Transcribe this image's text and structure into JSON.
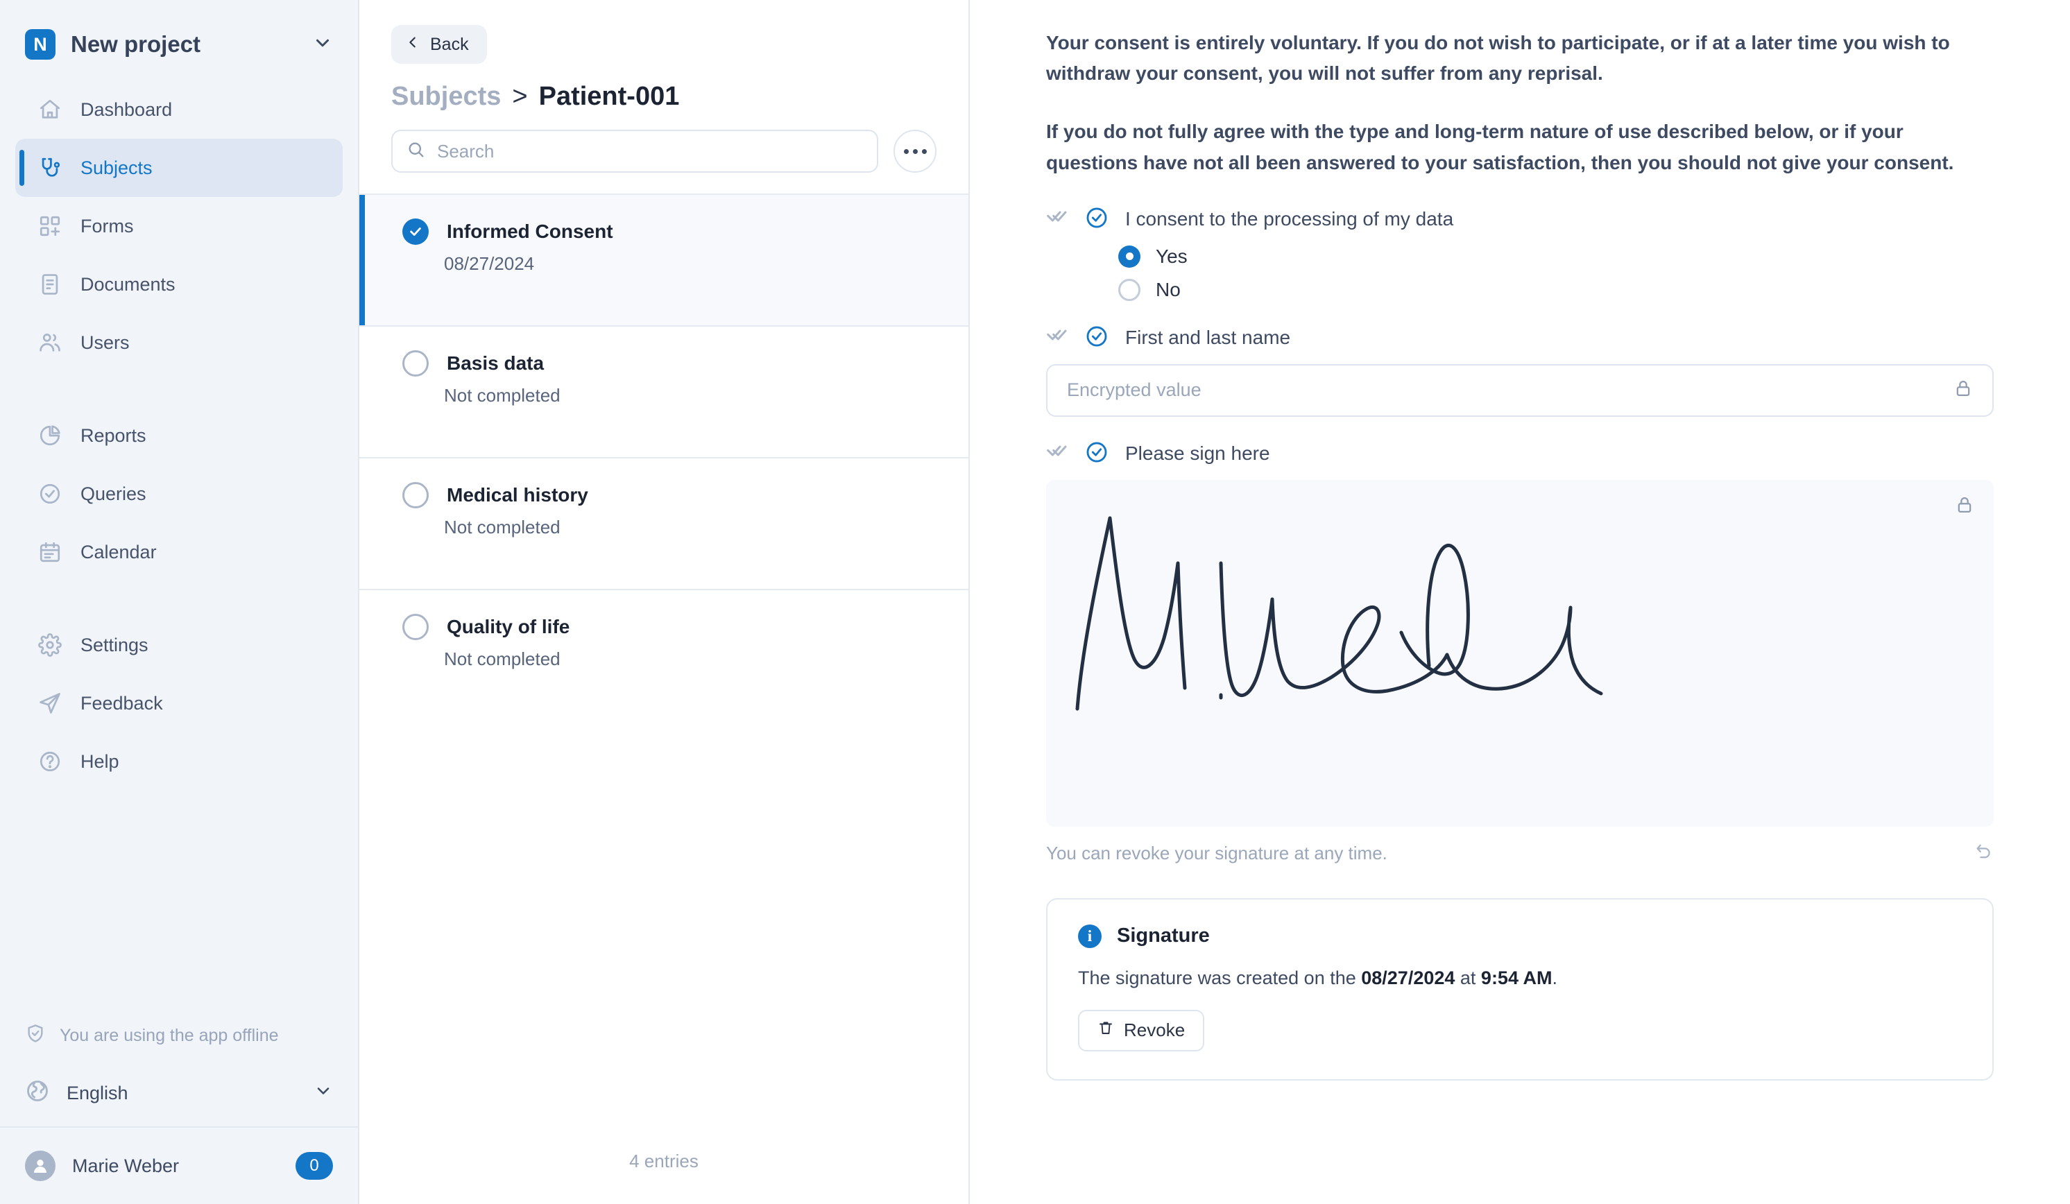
{
  "sidebar": {
    "project": {
      "logo_letter": "N",
      "name": "New project",
      "chevron_icon": "chevron-down-icon"
    },
    "items": [
      {
        "label": "Dashboard",
        "icon": "home-icon",
        "active": false
      },
      {
        "label": "Subjects",
        "icon": "stethoscope-icon",
        "active": true
      },
      {
        "label": "Forms",
        "icon": "forms-grid-plus-icon",
        "active": false
      },
      {
        "label": "Documents",
        "icon": "document-icon",
        "active": false
      },
      {
        "label": "Users",
        "icon": "users-icon",
        "active": false
      },
      {
        "label": "Reports",
        "icon": "pie-chart-icon",
        "active": false
      },
      {
        "label": "Queries",
        "icon": "check-circle-icon",
        "active": false
      },
      {
        "label": "Calendar",
        "icon": "calendar-icon",
        "active": false
      },
      {
        "label": "Settings",
        "icon": "gear-icon",
        "active": false
      },
      {
        "label": "Feedback",
        "icon": "paper-plane-icon",
        "active": false
      },
      {
        "label": "Help",
        "icon": "question-circle-icon",
        "active": false
      }
    ],
    "offline_status": "You are using the app offline",
    "offline_icon": "shield-check-icon",
    "language": "English",
    "language_icon": "globe-icon",
    "user": {
      "name": "Marie Weber",
      "badge_count": "0",
      "avatar_icon": "user-avatar-icon"
    }
  },
  "list_panel": {
    "back_label": "Back",
    "back_icon": "chevron-left-icon",
    "breadcrumb": {
      "parent": "Subjects",
      "separator": ">",
      "current": "Patient-001"
    },
    "search": {
      "placeholder": "Search",
      "value": "",
      "icon": "search-icon"
    },
    "more_button_icon": "ellipsis-icon",
    "items": [
      {
        "title": "Informed Consent",
        "subtitle": "08/27/2024",
        "completed": true,
        "selected": true
      },
      {
        "title": "Basis data",
        "subtitle": "Not completed",
        "completed": false,
        "selected": false
      },
      {
        "title": "Medical history",
        "subtitle": "Not completed",
        "completed": false,
        "selected": false
      },
      {
        "title": "Quality of life",
        "subtitle": "Not completed",
        "completed": false,
        "selected": false
      }
    ],
    "entries_count": "4 entries"
  },
  "detail": {
    "paragraph_1": "Your consent is entirely voluntary. If you do not wish to participate, or if at a later time you wish to withdraw your consent, you will not suffer from any reprisal.",
    "paragraph_2": "If you do not fully agree with the type and long-term nature of use described below, or if your questions have not all been answered to your satisfaction, then you should not give your consent.",
    "consent_question": {
      "label": "I consent to the processing of my data",
      "saved_icon": "double-check-icon",
      "status_icon": "check-circle-outline-icon",
      "options": [
        {
          "label": "Yes",
          "selected": true
        },
        {
          "label": "No",
          "selected": false
        }
      ]
    },
    "name_field": {
      "label": "First and last name",
      "saved_icon": "double-check-icon",
      "status_icon": "check-circle-outline-icon",
      "placeholder": "Encrypted value",
      "value": "",
      "lock_icon": "lock-icon"
    },
    "signature_field": {
      "label": "Please sign here",
      "saved_icon": "double-check-icon",
      "status_icon": "check-circle-outline-icon",
      "lock_icon": "lock-icon",
      "revoke_note": "You can revoke your signature at any time.",
      "undo_icon": "undo-icon"
    },
    "signature_info": {
      "badge_icon": "info-icon",
      "title": "Signature",
      "text_prefix": "The signature was created on the ",
      "date": "08/27/2024",
      "text_middle": " at ",
      "time": "9:54 AM",
      "text_suffix": ".",
      "revoke_label": "Revoke",
      "revoke_icon": "trash-icon"
    }
  },
  "colors": {
    "accent": "#1476c6",
    "sidebar_bg": "#f1f4f9",
    "text_dark": "#1c2434",
    "text_muted": "#9aa6ba",
    "signature_ink": "#232f42"
  }
}
